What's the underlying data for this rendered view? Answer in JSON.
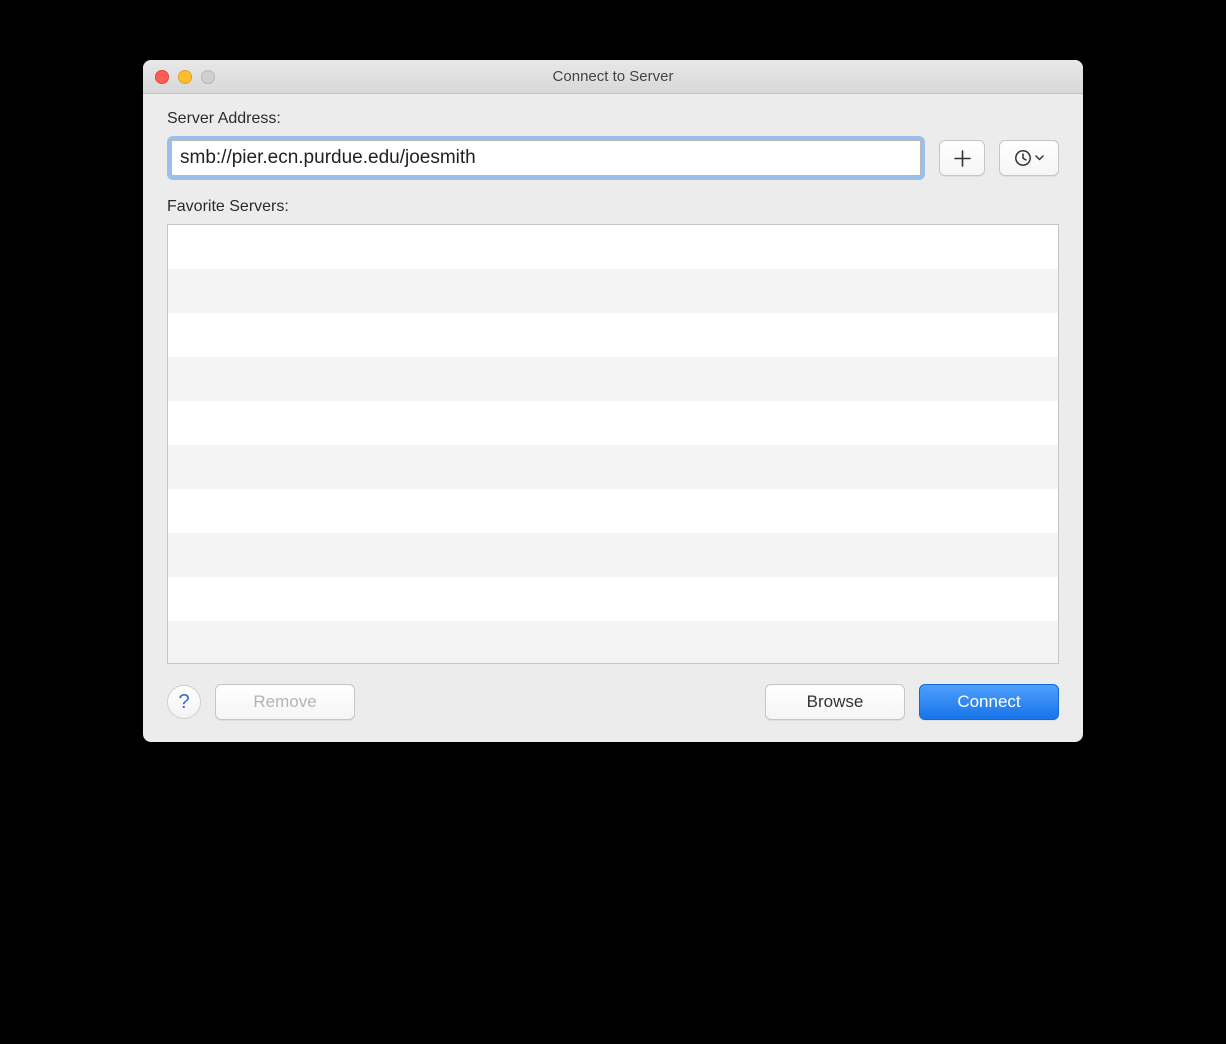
{
  "window": {
    "title": "Connect to Server"
  },
  "labels": {
    "server_address": "Server Address:",
    "favorite_servers": "Favorite Servers:"
  },
  "address": {
    "value": "smb://pier.ecn.purdue.edu/joesmith"
  },
  "buttons": {
    "add": "+",
    "help": "?",
    "remove": "Remove",
    "browse": "Browse",
    "connect": "Connect"
  },
  "favorites": []
}
